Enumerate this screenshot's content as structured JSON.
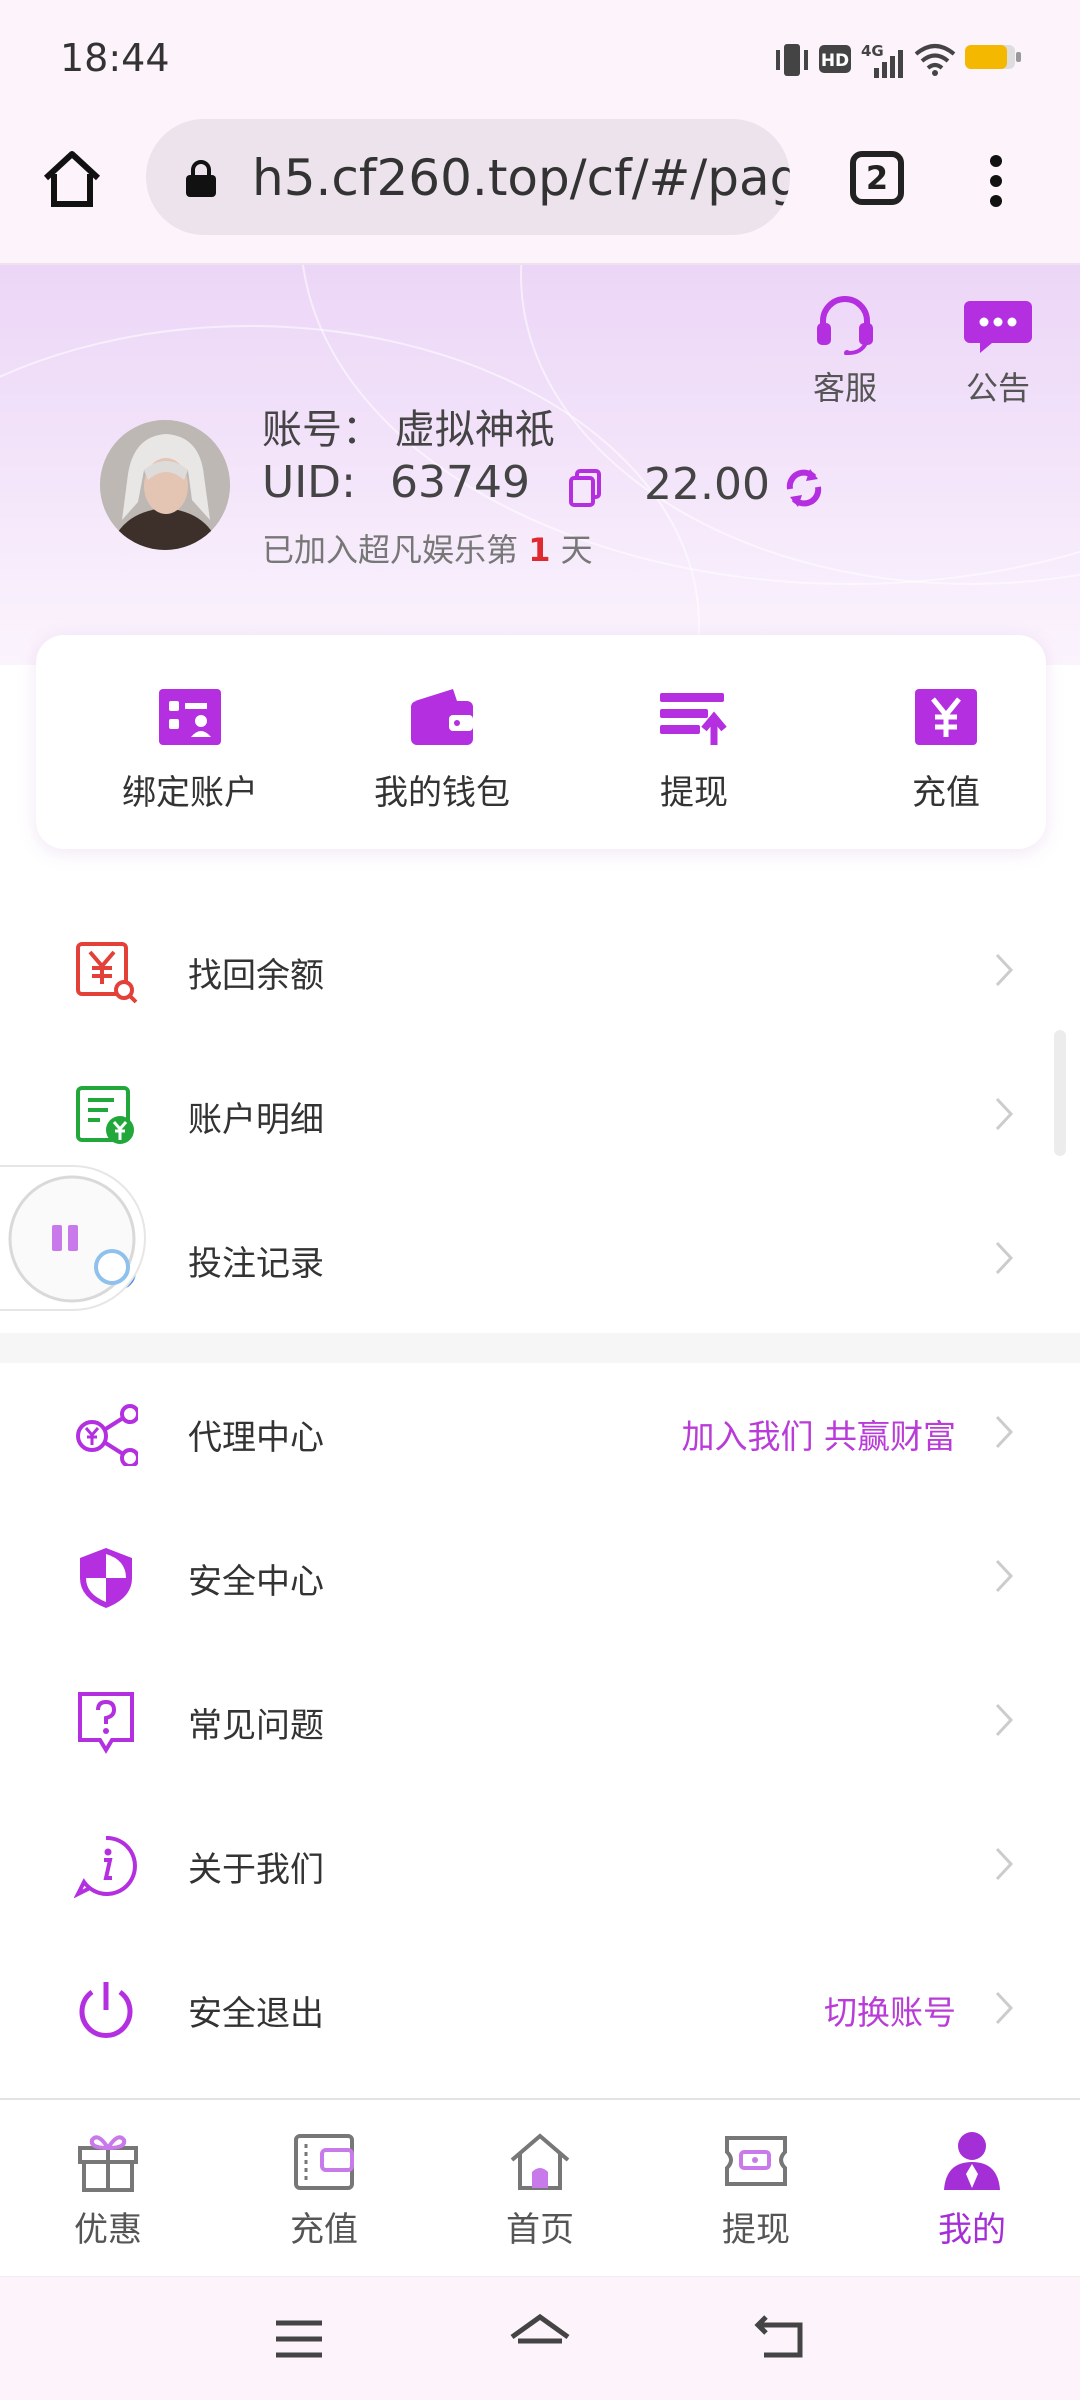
{
  "status_bar": {
    "time": "18:44",
    "network": "4G"
  },
  "browser": {
    "url": "h5.cf260.top/cf/#/page",
    "tab_count": "2"
  },
  "header": {
    "service_label": "客服",
    "notice_label": "公告",
    "account_line": "账号：  虚拟神祇",
    "uid_label": "UID:",
    "uid_value": "63749",
    "balance": "22.00",
    "join_prefix": "已加入超凡娱乐第",
    "join_days": "1",
    "join_suffix": "天"
  },
  "quick_actions": [
    {
      "label": "绑定账户",
      "icon": "bind-account-icon"
    },
    {
      "label": "我的钱包",
      "icon": "wallet-icon"
    },
    {
      "label": "提现",
      "icon": "withdraw-icon"
    },
    {
      "label": "充值",
      "icon": "recharge-icon"
    }
  ],
  "menu_group_1": [
    {
      "label": "找回余额",
      "icon": "recover-balance-icon"
    },
    {
      "label": "账户明细",
      "icon": "account-details-icon"
    },
    {
      "label": "投注记录",
      "icon": "bet-record-icon"
    }
  ],
  "menu_group_2": [
    {
      "label": "代理中心",
      "extra": "加入我们 共赢财富",
      "icon": "agent-center-icon"
    },
    {
      "label": "安全中心",
      "extra": "",
      "icon": "shield-icon"
    },
    {
      "label": "常见问题",
      "extra": "",
      "icon": "faq-icon"
    },
    {
      "label": "关于我们",
      "extra": "",
      "icon": "info-icon"
    },
    {
      "label": "安全退出",
      "extra": "切换账号",
      "icon": "power-icon"
    }
  ],
  "bottom_nav": [
    {
      "label": "优惠",
      "icon": "gift-icon"
    },
    {
      "label": "充值",
      "icon": "wallet-icon"
    },
    {
      "label": "首页",
      "icon": "home-icon"
    },
    {
      "label": "提现",
      "icon": "ticket-icon"
    },
    {
      "label": "我的",
      "icon": "user-icon",
      "active": true
    }
  ],
  "colors": {
    "accent": "#b32fe0",
    "red": "#e0282f",
    "green": "#22a83a"
  }
}
